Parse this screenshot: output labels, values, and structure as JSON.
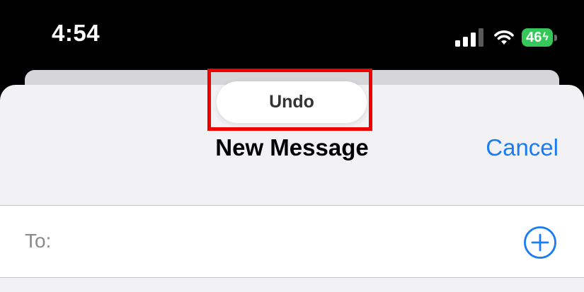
{
  "status_bar": {
    "time": "4:54",
    "battery_level": "46",
    "battery_charging_glyph": "ϟ",
    "signal_bars_active": 3,
    "signal_bars_total": 4,
    "icons": [
      "signal-icon",
      "wifi-icon",
      "battery-icon",
      "charging-bolt-icon"
    ]
  },
  "undo_toast": {
    "label": "Undo"
  },
  "header": {
    "title": "New Message",
    "cancel_label": "Cancel"
  },
  "recipient": {
    "label": "To:",
    "value": "",
    "add_icon": "plus-circle-icon"
  },
  "colors": {
    "accent": "#1a7cf5",
    "battery": "#35c759",
    "highlight": "#ee0000",
    "sheet_background": "#f2f2f4"
  }
}
